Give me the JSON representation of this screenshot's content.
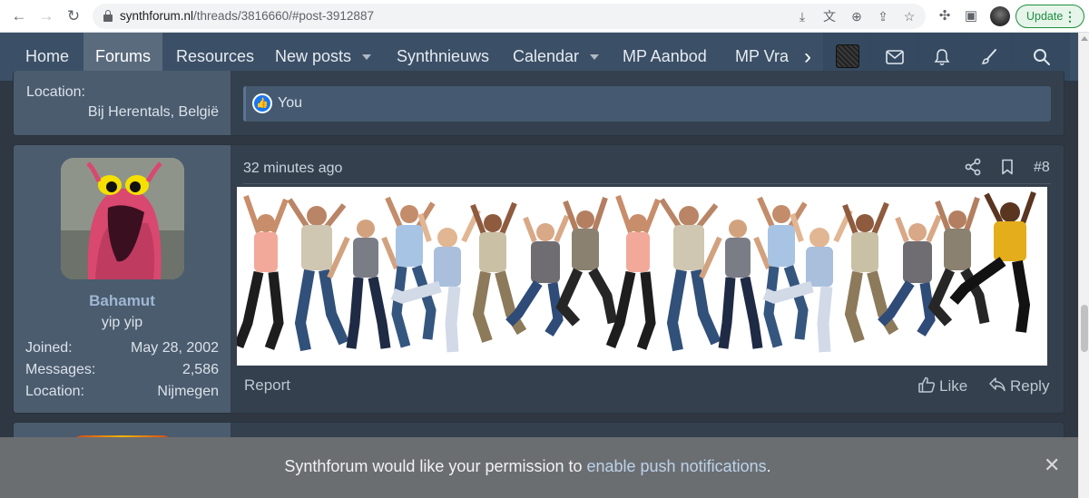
{
  "browser": {
    "url_domain": "synthforum.nl",
    "url_path": "/threads/3816660/#post-3912887",
    "update_label": "Update",
    "update_menu": "⋮"
  },
  "nav": {
    "items": [
      {
        "label": "Home"
      },
      {
        "label": "Forums"
      },
      {
        "label": "Resources"
      },
      {
        "label": "New posts"
      },
      {
        "label": "Synthnieuws"
      },
      {
        "label": "Calendar"
      },
      {
        "label": "MP Aanbod"
      },
      {
        "label": "MP Vra"
      }
    ]
  },
  "prev_post": {
    "location_label": "Location:",
    "location_value": "Bij Herentals, België",
    "reactions": "You"
  },
  "post": {
    "username": "Bahamut",
    "user_title": "yip yip",
    "stats": [
      {
        "label": "Joined:",
        "value": "May 28, 2002"
      },
      {
        "label": "Messages:",
        "value": "2,586"
      },
      {
        "label": "Location:",
        "value": "Nijmegen"
      }
    ],
    "time": "32 minutes ago",
    "number": "#8",
    "report": "Report",
    "like": "Like",
    "reply": "Reply"
  },
  "push": {
    "text_before": "Synthforum would like your permission to ",
    "link": "enable push notifications",
    "text_after": ".",
    "close": "✕"
  },
  "colors": {
    "nav_bg": "#3b4f66",
    "user_col_bg": "#4b5c6e",
    "post_bg": "#34404d",
    "username": "#9fb7d2",
    "push_bg": "#6b6e71"
  }
}
